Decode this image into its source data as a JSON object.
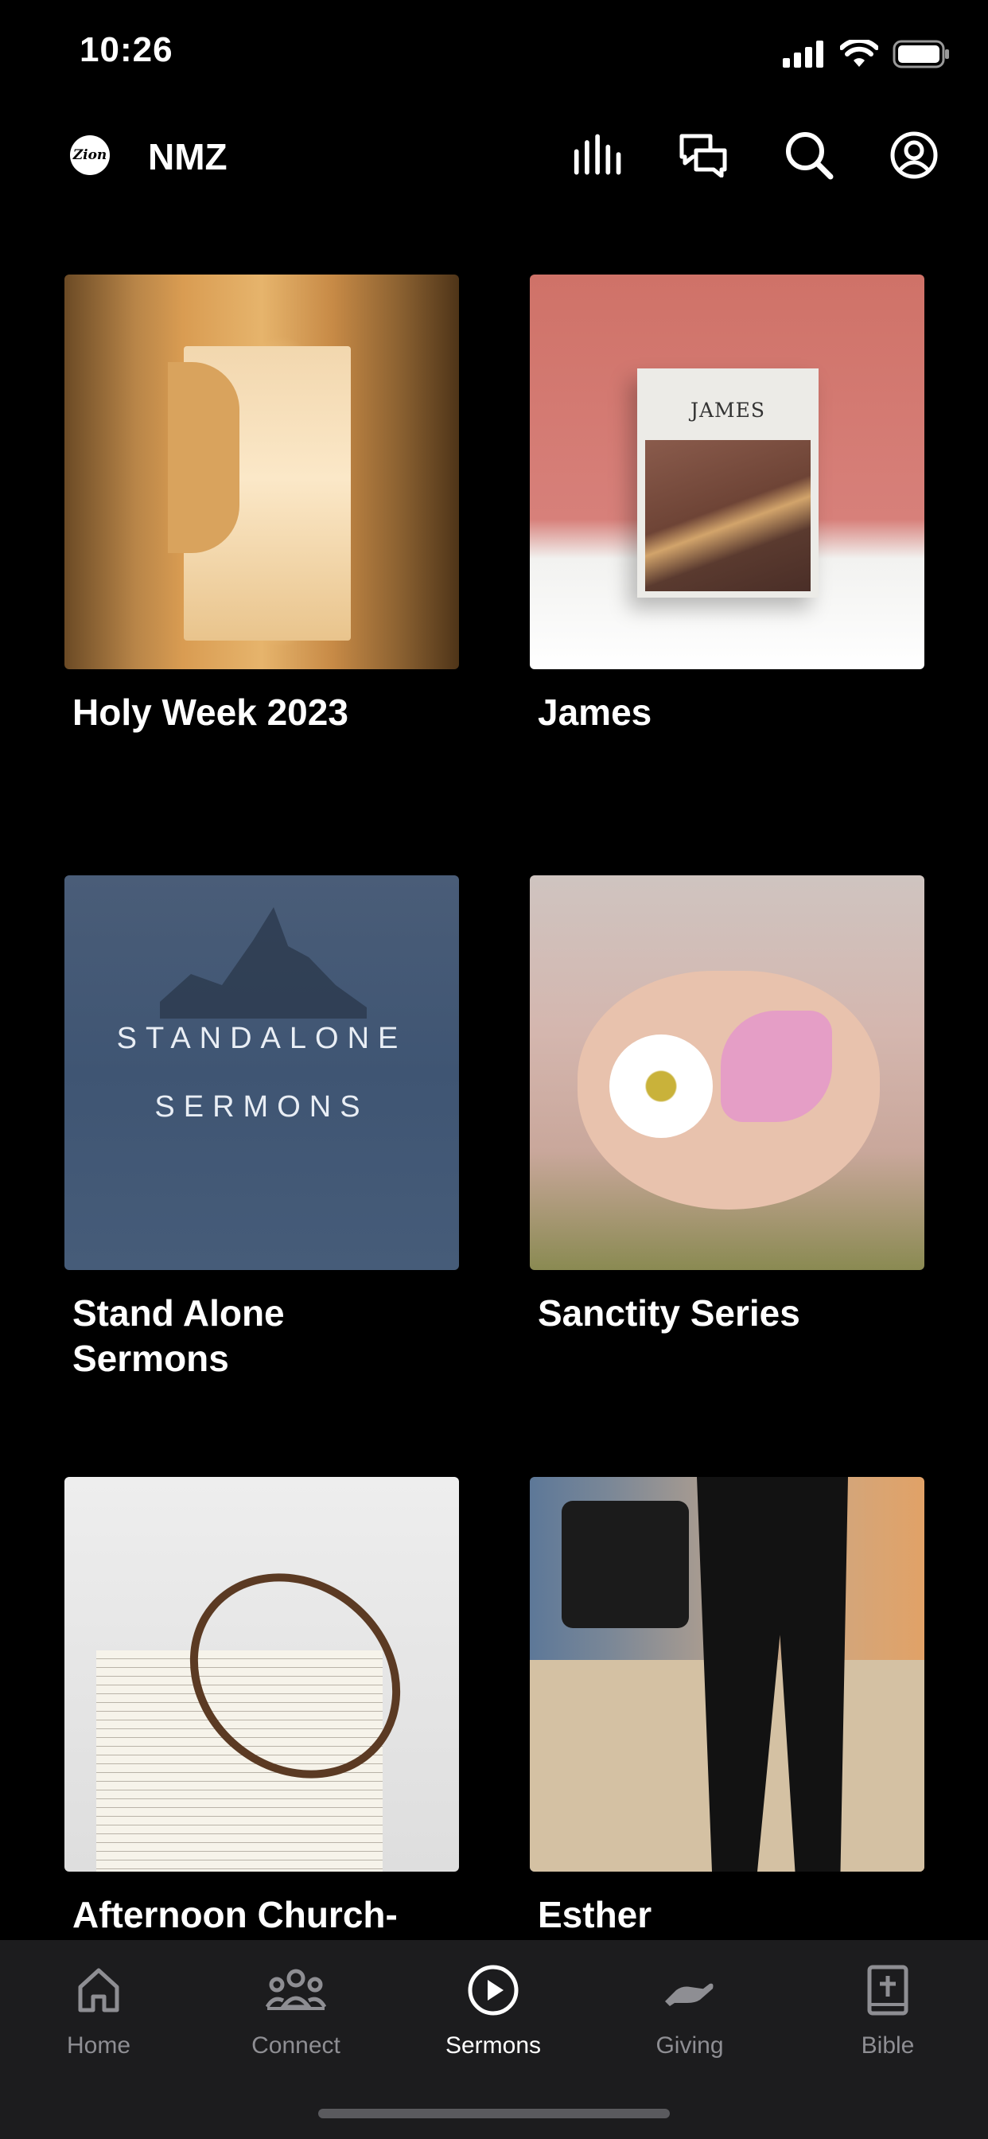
{
  "status_bar": {
    "time": "10:26"
  },
  "header": {
    "logo_text": "Zion",
    "title": "NMZ"
  },
  "series": [
    {
      "title": "Holy Week 2023"
    },
    {
      "title": "James",
      "cover_text": "JAMES"
    },
    {
      "title": "Stand Alone Sermons",
      "cover_lines": [
        "STANDALONE",
        "SERMONS"
      ]
    },
    {
      "title": "Sanctity Series"
    },
    {
      "title": "Afternoon Church-"
    },
    {
      "title": "Esther"
    }
  ],
  "tabs": [
    {
      "label": "Home",
      "icon": "home-icon"
    },
    {
      "label": "Connect",
      "icon": "people-icon"
    },
    {
      "label": "Sermons",
      "icon": "play-circle-icon",
      "active": true
    },
    {
      "label": "Giving",
      "icon": "giving-hand-icon"
    },
    {
      "label": "Bible",
      "icon": "bible-icon"
    }
  ],
  "colors": {
    "background": "#000000",
    "tabbar": "#1c1c1e",
    "tab_inactive": "#8e8e93",
    "tab_active": "#ffffff"
  }
}
